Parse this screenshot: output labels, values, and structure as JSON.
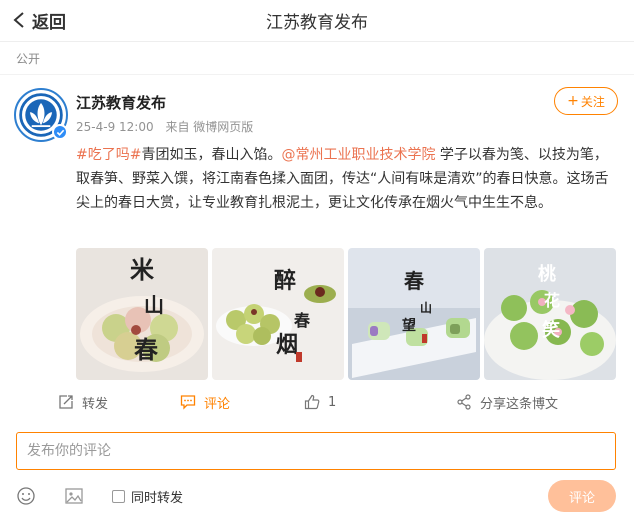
{
  "header": {
    "back_label": "返回",
    "title": "江苏教育发布"
  },
  "visibility": "公开",
  "post": {
    "author": "江苏教育发布",
    "date": "25-4-9 12:00",
    "source": "来自 微博网页版",
    "follow_label": "关注",
    "content": {
      "hashtag": "#吃了吗#",
      "text1": "青团如玉，春山入馅。",
      "mention": "@常州工业职业技术学院",
      "text2": " 学子以春为笺、以技为笔，取春笋、野菜入馔，将江南春色揉入面团，传达“人间有味是清欢”的春日快意。这场舌尖上的春日大赏，让专业教育扎根泥土，更让文化传承在烟火气中生生不息。"
    },
    "images": [
      {
        "caption": "米山春"
      },
      {
        "caption": "醉春烟"
      },
      {
        "caption": "春山望"
      },
      {
        "caption": "桃花笑"
      }
    ],
    "actions": {
      "repost_label": "转发",
      "comment_label": "评论",
      "like_count": "1",
      "share_label": "分享这条博文"
    }
  },
  "comment": {
    "placeholder": "发布你的评论",
    "repost_label": "同时转发",
    "submit_label": "评论"
  },
  "colors": {
    "accent": "#ff8200",
    "link": "#eb7350",
    "verify": "#2e8df7"
  }
}
